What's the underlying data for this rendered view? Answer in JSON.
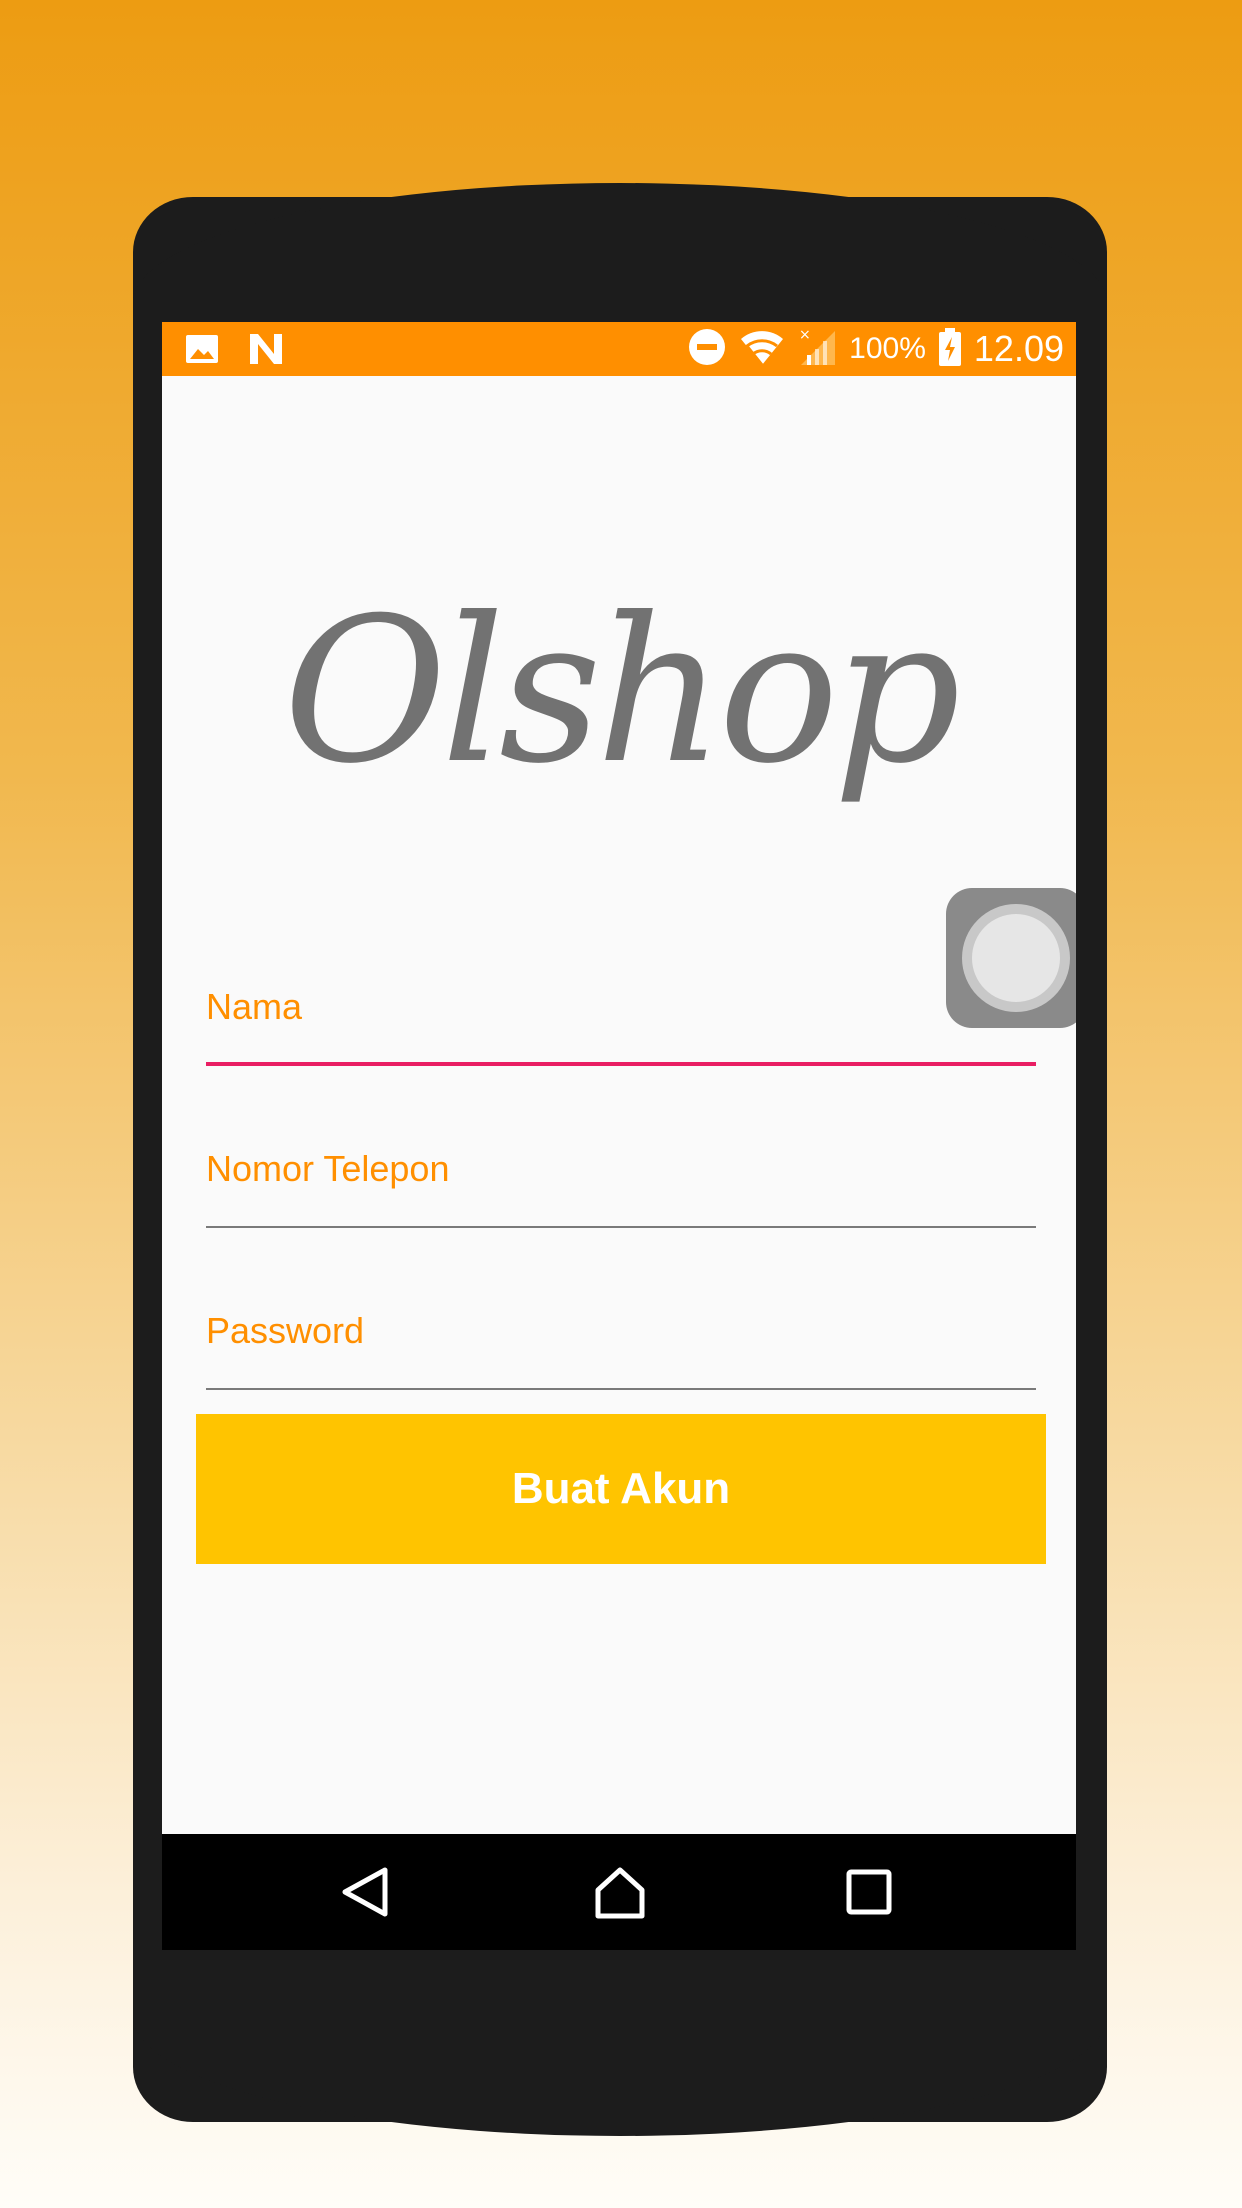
{
  "status_bar": {
    "icons_left": [
      "image-icon",
      "n-icon"
    ],
    "icons_right": [
      "do-not-disturb-icon",
      "wifi-icon",
      "signal-icon",
      "battery-icon"
    ],
    "battery_percent": "100%",
    "time": "12.09"
  },
  "logo": {
    "text": "Olshop"
  },
  "form": {
    "fields": [
      {
        "label": "Nama",
        "active": true
      },
      {
        "label": "Nomor Telepon",
        "active": false
      },
      {
        "label": "Password",
        "active": false
      }
    ],
    "submit_label": "Buat Akun"
  },
  "nav_bar": {
    "buttons": [
      "back-icon",
      "home-icon",
      "recent-apps-icon"
    ]
  },
  "colors": {
    "status_bar": "#FF8F00",
    "label": "#FF8F00",
    "active_underline": "#E91E63",
    "button": "#FFC400",
    "logo": "#727272"
  }
}
